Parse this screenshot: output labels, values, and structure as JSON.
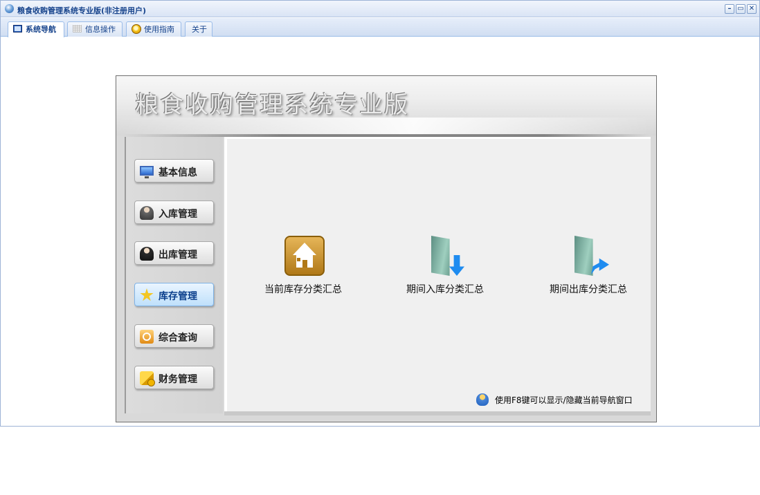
{
  "window": {
    "title": "粮食收购管理系统专业版(非注册用户)",
    "controls": [
      "–",
      "▭",
      "✕"
    ]
  },
  "tabs": [
    {
      "label": "系统导航",
      "icon": "monitor-icon",
      "active": true
    },
    {
      "label": "信息操作",
      "icon": "grid-icon",
      "active": false
    },
    {
      "label": "使用指南",
      "icon": "info-icon",
      "active": false
    },
    {
      "label": "关于",
      "icon": "",
      "active": false
    }
  ],
  "banner": {
    "title": "粮食收购管理系统专业版"
  },
  "sidebar": {
    "items": [
      {
        "label": "基本信息",
        "icon": "monitor-icon",
        "active": false
      },
      {
        "label": "入库管理",
        "icon": "person-icon",
        "active": false
      },
      {
        "label": "出库管理",
        "icon": "person-icon",
        "active": false
      },
      {
        "label": "库存管理",
        "icon": "star-icon",
        "active": true
      },
      {
        "label": "综合查询",
        "icon": "search-icon",
        "active": false
      },
      {
        "label": "财务管理",
        "icon": "finance-icon",
        "active": false
      }
    ]
  },
  "features": [
    {
      "label": "当前库存分类汇总",
      "icon": "house-icon"
    },
    {
      "label": "期间入库分类汇总",
      "icon": "folder-in-icon"
    },
    {
      "label": "期间出库分类汇总",
      "icon": "folder-out-icon"
    }
  ],
  "tip": {
    "text": "使用F8键可以显示/隐藏当前导航窗口",
    "icon": "user-icon"
  }
}
